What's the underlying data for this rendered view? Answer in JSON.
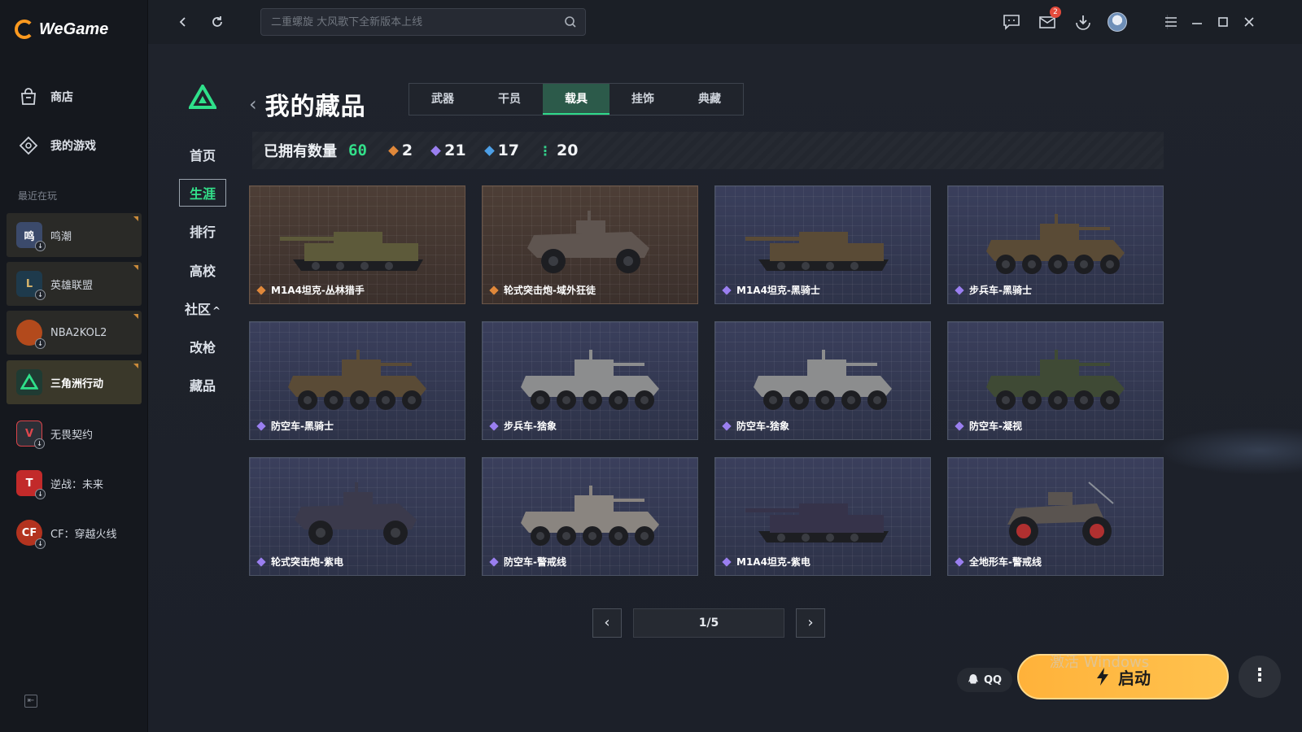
{
  "app": {
    "name": "WeGame"
  },
  "sidebar": {
    "nav": [
      {
        "label": "商店",
        "icon": "store-icon"
      },
      {
        "label": "我的游戏",
        "icon": "my-games-icon"
      }
    ],
    "recent_label": "最近在玩",
    "games": [
      {
        "label": "鸣潮",
        "color": "#3b4a6b"
      },
      {
        "label": "英雄联盟",
        "color": "#1e3a4c"
      },
      {
        "label": "NBA2KOL2",
        "color": "#b34a1c"
      },
      {
        "label": "三角洲行动",
        "color": "#1f3b33"
      },
      {
        "label": "无畏契约",
        "color": "#2c2f37"
      },
      {
        "label": "逆战：未来",
        "color": "#c22a2a"
      },
      {
        "label": "CF：穿越火线",
        "color": "#b3331f"
      }
    ]
  },
  "topbar": {
    "search_placeholder": "二重螺旋 大风歌下全新版本上线",
    "mail_badge": "2"
  },
  "page": {
    "side_tabs": [
      "首页",
      "生涯",
      "排行",
      "高校",
      "社区",
      "改枪",
      "藏品"
    ],
    "community_chevron": "^",
    "title": "我的藏品",
    "tabs": [
      "武器",
      "干员",
      "载具",
      "挂饰",
      "典藏"
    ],
    "active_tab": "载具",
    "stats": {
      "label": "已拥有数量",
      "total": "60",
      "items": [
        {
          "value": "2",
          "color": "#e0883a"
        },
        {
          "value": "21",
          "color": "#9a7ff0"
        },
        {
          "value": "17",
          "color": "#4d9fe6"
        },
        {
          "value": "20",
          "color": "#33d08a"
        }
      ]
    },
    "cards": [
      {
        "name": "M1A4坦克-丛林猎手",
        "rarity": "gold",
        "kind": "tank",
        "camo": "#5d5a3a"
      },
      {
        "name": "轮式突击炮-域外狂徒",
        "rarity": "gold",
        "kind": "wheeled4",
        "camo": "#5f5550"
      },
      {
        "name": "M1A4坦克-黑骑士",
        "rarity": "purple",
        "kind": "tank",
        "camo": "#5a4b36"
      },
      {
        "name": "步兵车-黑骑士",
        "rarity": "purple",
        "kind": "apc",
        "camo": "#5a4b36"
      },
      {
        "name": "防空车-黑骑士",
        "rarity": "purple",
        "kind": "apc",
        "camo": "#5a4b36"
      },
      {
        "name": "步兵车-猞象",
        "rarity": "purple",
        "kind": "apc",
        "camo": "#8c8d8e"
      },
      {
        "name": "防空车-猞象",
        "rarity": "purple",
        "kind": "apc",
        "camo": "#8c8d8e"
      },
      {
        "name": "防空车-凝视",
        "rarity": "purple",
        "kind": "apc",
        "camo": "#3f4a35"
      },
      {
        "name": "轮式突击炮-紫电",
        "rarity": "purple",
        "kind": "wheeled4",
        "camo": "#3b3a4c"
      },
      {
        "name": "防空车-警戒线",
        "rarity": "purple",
        "kind": "apc",
        "camo": "#8a8580"
      },
      {
        "name": "M1A4坦克-紫电",
        "rarity": "purple",
        "kind": "tank",
        "camo": "#36334a"
      },
      {
        "name": "全地形车-警戒线",
        "rarity": "purple",
        "kind": "atv",
        "camo": "#5a5450"
      }
    ],
    "pagination": {
      "display": "1/5"
    },
    "qq_label": "QQ",
    "launch_label": "启动"
  },
  "watermark": "激活 Windows"
}
